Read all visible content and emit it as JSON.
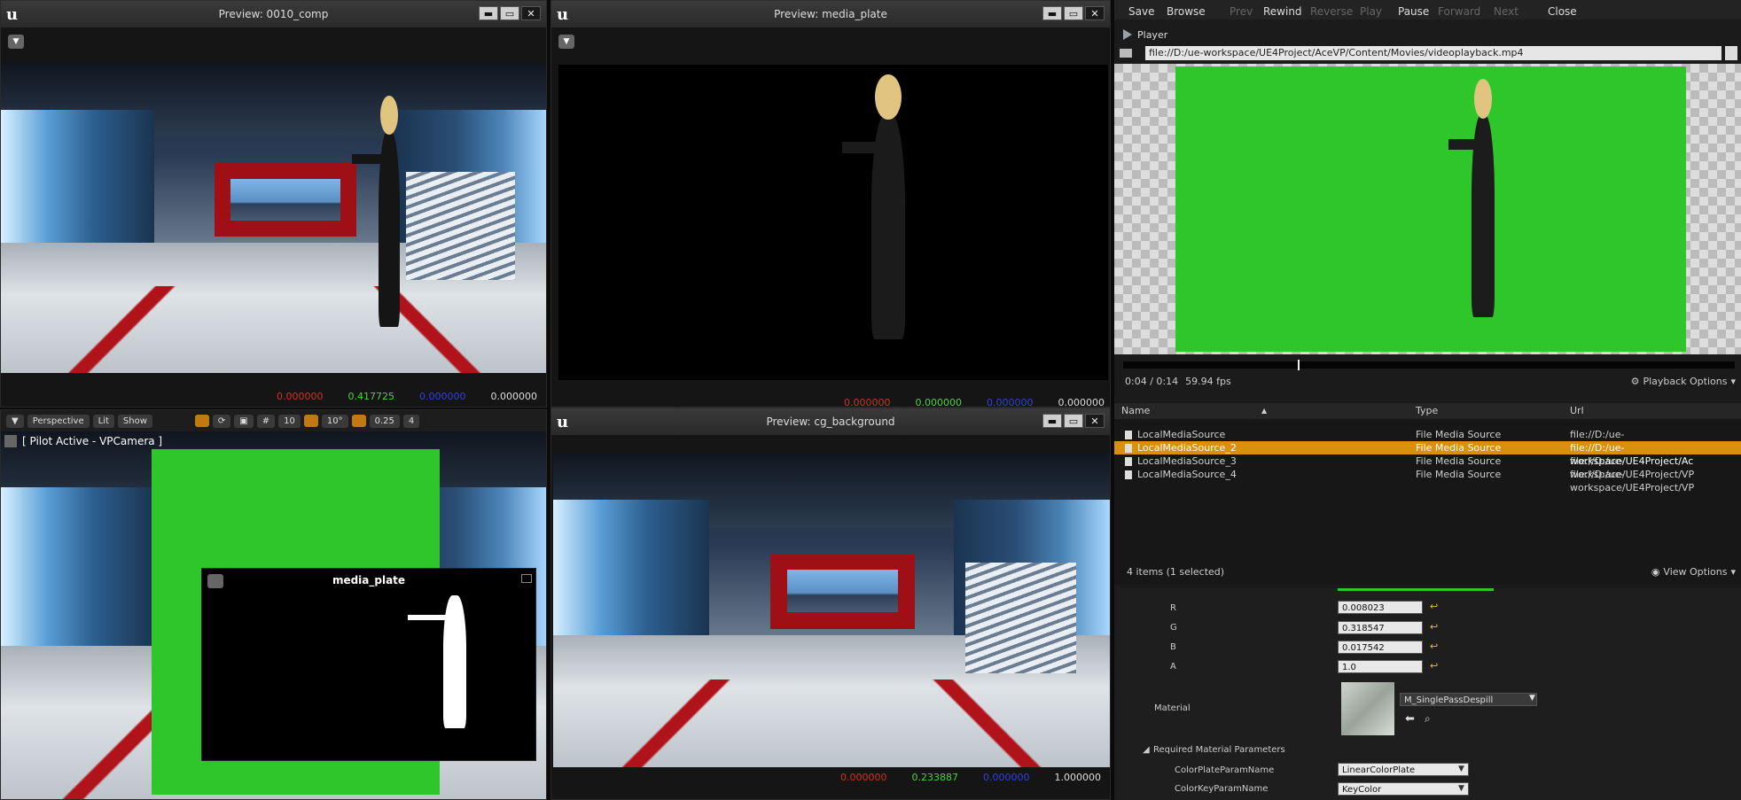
{
  "preview_comp": {
    "title": "Preview: 0010_comp",
    "readout": {
      "r": "0.000000",
      "g": "0.417725",
      "b": "0.000000",
      "a": "0.000000"
    }
  },
  "preview_media": {
    "title": "Preview: media_plate",
    "readout": {
      "r": "0.000000",
      "g": "0.000000",
      "b": "0.000000",
      "a": "0.000000"
    }
  },
  "preview_bg": {
    "title": "Preview: cg_background",
    "readout": {
      "r": "0.000000",
      "g": "0.233887",
      "b": "0.000000",
      "a": "1.000000"
    }
  },
  "viewport": {
    "toolbar": {
      "perspective": "Perspective",
      "lit": "Lit",
      "show": "Show",
      "grid": "10",
      "angle": "10°",
      "scale": "0.25",
      "cam": "4"
    },
    "pilot_label": "[ Pilot Active - VPCamera ]",
    "sub_title": "media_plate"
  },
  "player": {
    "toolbar": [
      "Save",
      "Browse",
      "Prev",
      "Rewind",
      "Reverse",
      "Play",
      "Pause",
      "Forward",
      "Next",
      "Close"
    ],
    "toolbar_disabled": [
      false,
      false,
      true,
      false,
      true,
      true,
      false,
      true,
      true,
      false
    ],
    "tab": "Player",
    "url": "file://D:/ue-workspace/UE4Project/AceVP/Content/Movies/videoplayback.mp4",
    "time": "0:04 / 0:14",
    "fps": "59.94 fps",
    "progress": 0.286,
    "playback_options": "Playback Options"
  },
  "sources": {
    "headers": {
      "name": "Name",
      "type": "Type",
      "url": "Url"
    },
    "rows": [
      {
        "name": "LocalMediaSource",
        "type": "File Media Source",
        "url": "file://D:/ue-workspace/UE4Project/VP",
        "selected": false
      },
      {
        "name": "LocalMediaSource_2",
        "type": "File Media Source",
        "url": "file://D:/ue-workspace/UE4Project/Ac",
        "selected": true
      },
      {
        "name": "LocalMediaSource_3",
        "type": "File Media Source",
        "url": "file://D:/ue-workspace/UE4Project/VP",
        "selected": false
      },
      {
        "name": "LocalMediaSource_4",
        "type": "File Media Source",
        "url": "file://D:/ue-workspace/UE4Project/VP",
        "selected": false
      }
    ],
    "count": "4 items (1 selected)",
    "view_options": "View Options"
  },
  "details": {
    "r_label": "R",
    "r_value": "0.008023",
    "g_label": "G",
    "g_value": "0.318547",
    "b_label": "B",
    "b_value": "0.017542",
    "a_label": "A",
    "a_value": "1.0",
    "material_label": "Material",
    "material_value": "M_SinglePassDespill",
    "required_params": "Required Material Parameters",
    "color_plate_label": "ColorPlateParamName",
    "color_plate_value": "LinearColorPlate",
    "color_key_label": "ColorKeyParamName",
    "color_key_value": "KeyColor"
  },
  "colors": {
    "selected_row": "#d9900e",
    "green_screen": "#2ec62a"
  }
}
